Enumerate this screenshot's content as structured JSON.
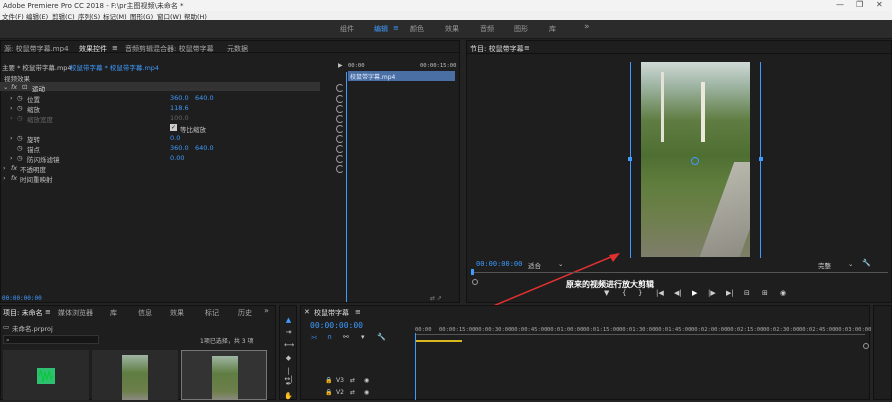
{
  "app": {
    "title": "Adobe Premiere Pro CC 2018 - F:\\pr主图视频\\未命名 *",
    "window_controls": [
      "—",
      "❐",
      "✕"
    ]
  },
  "menu": [
    "文件(F)",
    "编辑(E)",
    "剪辑(C)",
    "序列(S)",
    "标记(M)",
    "图形(G)",
    "窗口(W)",
    "帮助(H)"
  ],
  "workspaces": {
    "items": [
      "组件",
      "编辑",
      "颜色",
      "效果",
      "音频",
      "图形",
      "库"
    ],
    "active": "编辑",
    "more": "»"
  },
  "source_panel": {
    "tabs": [
      "源: 校鼠带字幕.mp4",
      "效果控件",
      "音频剪辑混合器: 校鼠带字幕",
      "元数据"
    ],
    "active_tab": "效果控件",
    "clip_path": "主要 * 校鼠带字幕.mp4",
    "clip_seq": "校鼠带字幕 * 校鼠带字幕.mp4",
    "timecode_start": "00:00",
    "timecode_end": "00:00:15:00",
    "clip_label": "校鼠带字幕.mp4",
    "video_effects": "视频效果",
    "motion": "运动",
    "position": {
      "label": "位置",
      "x": "360.0",
      "y": "640.0"
    },
    "scale": {
      "label": "缩放",
      "value": "118.6"
    },
    "scale_width": {
      "label": "缩放宽度",
      "value": "100.0"
    },
    "uniform": "等比缩放",
    "rotation": {
      "label": "旋转",
      "value": "0.0"
    },
    "anchor": {
      "label": "锚点",
      "x": "360.0",
      "y": "640.0"
    },
    "flicker": {
      "label": "防闪烁滤镜",
      "value": "0.00"
    },
    "opacity": "不透明度",
    "remap": "时间重映射",
    "footer_time": "00:00:00:00"
  },
  "program": {
    "tab": "节目: 校鼠带字幕",
    "timecode": "00:00:00:00",
    "fit": "适合",
    "quality": "完整",
    "annotation": "原来的视频进行放大剪辑"
  },
  "project": {
    "tabs": [
      "项目: 未命名",
      "媒体浏览器",
      "库",
      "信息",
      "效果",
      "标记",
      "历史"
    ],
    "file": "未命名.prproj",
    "selection": "1项已选择，共 3 项"
  },
  "timeline": {
    "tab": "校鼠带字幕",
    "timecode": "00:00:00:00",
    "ruler": [
      "00:00",
      "00:00:15:00",
      "00:00:30:00",
      "00:00:45:00",
      "00:01:00:00",
      "00:01:15:00",
      "00:01:30:00",
      "00:01:45:00",
      "00:02:00:00",
      "00:02:15:00",
      "00:02:30:00",
      "00:02:45:00",
      "00:03:00:00"
    ],
    "tracks": [
      "V3",
      "V2"
    ]
  },
  "colors": {
    "accent": "#3f9bff",
    "annotation": "#e03030"
  }
}
